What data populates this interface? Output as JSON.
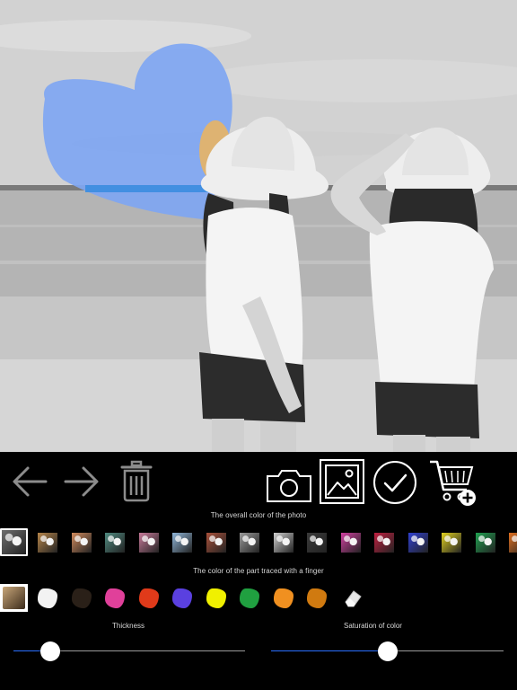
{
  "photo": {
    "subject": "two-people-on-beach",
    "brush_color": "#7fa6f2"
  },
  "toolbar": {
    "undo_icon": "arrow-left-icon",
    "redo_icon": "arrow-right-icon",
    "delete_icon": "trash-icon",
    "camera_icon": "camera-icon",
    "gallery_icon": "image-icon",
    "confirm_icon": "checkmark-circle-icon",
    "cart_icon": "cart-plus-icon"
  },
  "overall_color": {
    "title": "The overall color of the photo",
    "selected_index": 0,
    "filters": [
      {
        "name": "original",
        "color": "#6e6e6e"
      },
      {
        "name": "sepia",
        "color": "#b6854a"
      },
      {
        "name": "warm",
        "color": "#d08a5c"
      },
      {
        "name": "teal",
        "color": "#4f8a80"
      },
      {
        "name": "rose",
        "color": "#c87a9a"
      },
      {
        "name": "cool",
        "color": "#8fb5d8"
      },
      {
        "name": "vivid",
        "color": "#a8503a"
      },
      {
        "name": "sketch",
        "color": "#9a9a9a"
      },
      {
        "name": "mono-light",
        "color": "#cfcfcf"
      },
      {
        "name": "mono-dark",
        "color": "#3a3a3a"
      },
      {
        "name": "magenta",
        "color": "#d040a0"
      },
      {
        "name": "crimson",
        "color": "#c02040"
      },
      {
        "name": "blue",
        "color": "#3040d0"
      },
      {
        "name": "yellow",
        "color": "#e0d020"
      },
      {
        "name": "green",
        "color": "#20a050"
      },
      {
        "name": "orange",
        "color": "#e07020"
      }
    ]
  },
  "finger_color": {
    "title": "The color of the part traced with a finger",
    "selected_index": 0,
    "colors": [
      {
        "name": "original",
        "color": "#8a7a6a"
      },
      {
        "name": "white",
        "color": "#f2f2f2"
      },
      {
        "name": "black",
        "color": "#2a2018"
      },
      {
        "name": "pink",
        "color": "#e0409a"
      },
      {
        "name": "red",
        "color": "#e03a1a"
      },
      {
        "name": "violet",
        "color": "#5a40e0"
      },
      {
        "name": "yellow",
        "color": "#f0f000"
      },
      {
        "name": "green",
        "color": "#20a040"
      },
      {
        "name": "orange",
        "color": "#f09020"
      },
      {
        "name": "amber",
        "color": "#d07a10"
      }
    ],
    "eraser_icon": "eraser-icon"
  },
  "thickness": {
    "label": "Thickness",
    "value": 0.16
  },
  "saturation": {
    "label": "Saturation of color",
    "value": 0.5
  }
}
